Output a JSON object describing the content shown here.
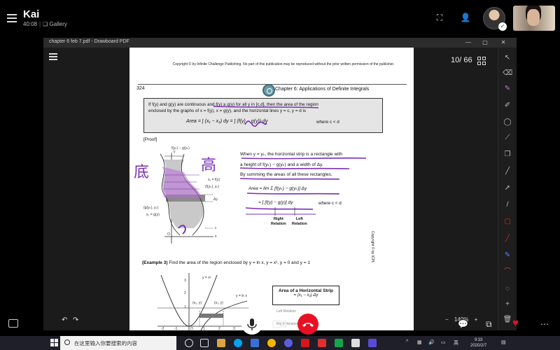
{
  "call": {
    "caller_name": "Kai",
    "duration": "40:08",
    "separator": "|",
    "gallery_label": "Gallery"
  },
  "window": {
    "title": "chapter 6 feb 7.pdf - Drawboard PDF",
    "page_indicator": "10/ 66"
  },
  "pdf": {
    "copyright": "Copyright © by Infinite Challenge Publishing. No part of this publication may be reproduced without the prior written permission of the publisher.",
    "page_number": "324",
    "chapter_title": "Chapter 6: Applications of Definite Integrals",
    "theorem_line1": "If f(y) and g(y) are continuous and f(y) ≥ g(y) for all y in [c,d], then the area of the region",
    "theorem_line2": "enclosed by the graphs of x = f(y), x = g(y), and the horizontal lines y = c, y = d is",
    "theorem_formula": "Area = ∫ (x₁ − x₂) dy = ∫ (f(y) − g(y)) dy",
    "theorem_where": "where c < d",
    "proof_label": "[Proof]",
    "para1": "When y = yₖ, the horizontal strip is a rectangle with",
    "para2": "a height of f(yₖ) − g(yₖ) and a width of Δy.",
    "para3": "By summing the areas of all these rectangles,",
    "eq1": "Area = lim Σ [f(yₖ) − g(yₖ)] Δy",
    "eq2": "= ∫ [f(y) − g(y)] dy",
    "eq_where": "where c < d",
    "right_relation": "Right\nRelation",
    "left_relation": "Left\nRelation",
    "vertical_note": "Copyright © by ICPL",
    "example_label": "(Example 3)",
    "example_text": "Find the area of the region enclosed by y = ln x, y = x², y = 0 and y = 1",
    "box_title": "Area of a Horizontal Strip",
    "box_formula": "= (x₁ − x₂) Δy",
    "figure_labels": {
      "top_strip": "f(yₖ) − g(yₖ)",
      "x1": "x₁ = f(y)",
      "fpt": "(f(yₖ), yₖ)",
      "dy": "Δy",
      "gpt": "(g(yₖ), yₖ)",
      "x2": "x₂ = g(y)",
      "c": "c",
      "o": "O",
      "x": "x",
      "y": "y"
    },
    "graph_labels": {
      "yx2": "y = x²",
      "ylnx": "y = ln x",
      "x2pt": "(x₂, y)",
      "x1pt": "(x₁, y)",
      "tick_3": "3",
      "tick_2": "2",
      "tick_1": "1",
      "tick_neg2": "-2",
      "tick_neg1": "-1",
      "tick_x1": "1",
      "tick_x2": "2",
      "tick_x3": "3",
      "o": "O",
      "left_rel": "Left Relation",
      "right_rel": "Right Relation"
    },
    "handwriting": {
      "left": "底",
      "right": "高"
    }
  },
  "controls": {
    "zoom_level": "140%",
    "zoom_minus": "−",
    "zoom_plus": "+"
  },
  "taskbar": {
    "search_placeholder": "在这里输入你要搜索的内容",
    "time": "9:33",
    "date": "2020/2/7",
    "ime": "英"
  },
  "colors": {
    "accent_ink": "#7a2fb5",
    "hangup": "#e81123",
    "heart": "#e81123"
  }
}
